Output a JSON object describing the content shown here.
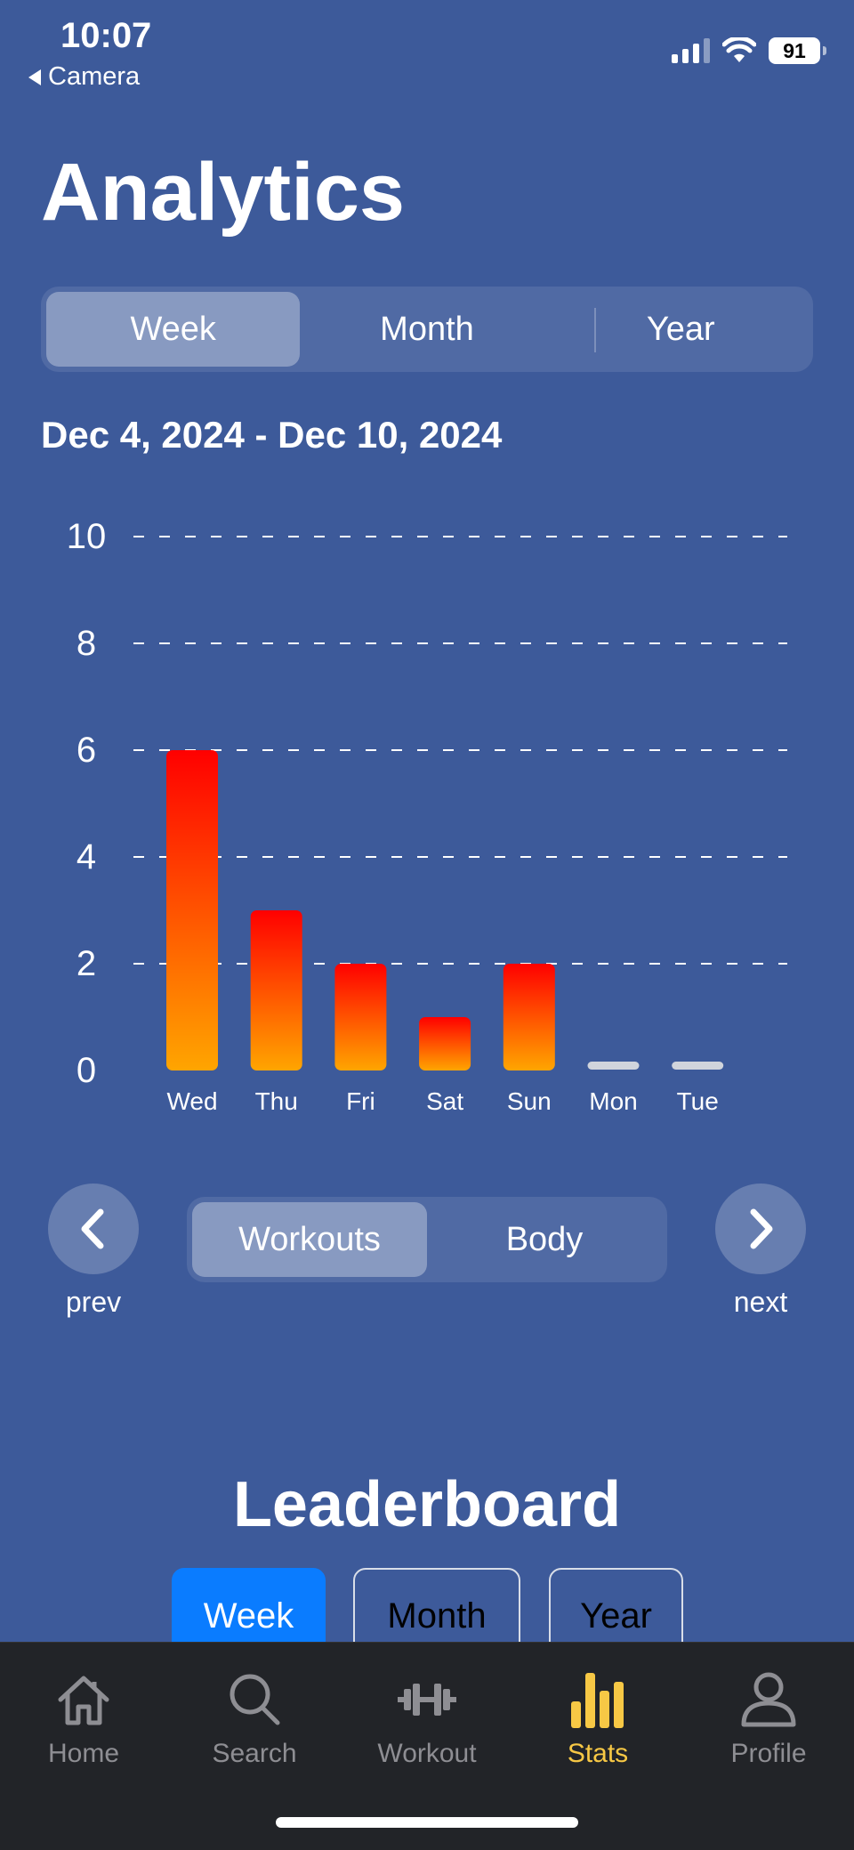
{
  "status": {
    "time": "10:07",
    "back_app": "Camera",
    "battery": "91"
  },
  "title": "Analytics",
  "period_tabs": [
    {
      "label": "Week",
      "active": true
    },
    {
      "label": "Month",
      "active": false
    },
    {
      "label": "Year",
      "active": false
    }
  ],
  "date_range": "Dec 4, 2024 - Dec 10, 2024",
  "chart_data": {
    "type": "bar",
    "categories": [
      "Wed",
      "Thu",
      "Fri",
      "Sat",
      "Sun",
      "Mon",
      "Tue"
    ],
    "values": [
      6,
      3,
      2,
      1,
      2,
      0,
      0
    ],
    "ylim": [
      0,
      10
    ],
    "yticks": [
      0,
      2,
      4,
      6,
      8,
      10
    ],
    "grid": true,
    "bar_gradient": [
      "#ff0000",
      "#ffa500"
    ],
    "zero_bar_color": "#d0d4dc"
  },
  "nav": {
    "prev_label": "prev",
    "next_label": "next",
    "metric_tabs": [
      {
        "label": "Workouts",
        "active": true
      },
      {
        "label": "Body",
        "active": false
      }
    ]
  },
  "leaderboard": {
    "title": "Leaderboard",
    "tabs": [
      {
        "label": "Week",
        "active": true
      },
      {
        "label": "Month",
        "active": false
      },
      {
        "label": "Year",
        "active": false
      }
    ]
  },
  "tabbar": [
    {
      "label": "Home",
      "icon": "home-icon",
      "active": false
    },
    {
      "label": "Search",
      "icon": "search-icon",
      "active": false
    },
    {
      "label": "Workout",
      "icon": "dumbbell-icon",
      "active": false
    },
    {
      "label": "Stats",
      "icon": "bar-chart-icon",
      "active": true
    },
    {
      "label": "Profile",
      "icon": "person-icon",
      "active": false
    }
  ],
  "colors": {
    "background": "#3d5a9a",
    "accent_active_tab": "#f7c845",
    "leaderboard_active": "#0a7cff",
    "tabbar_bg": "#222428"
  }
}
